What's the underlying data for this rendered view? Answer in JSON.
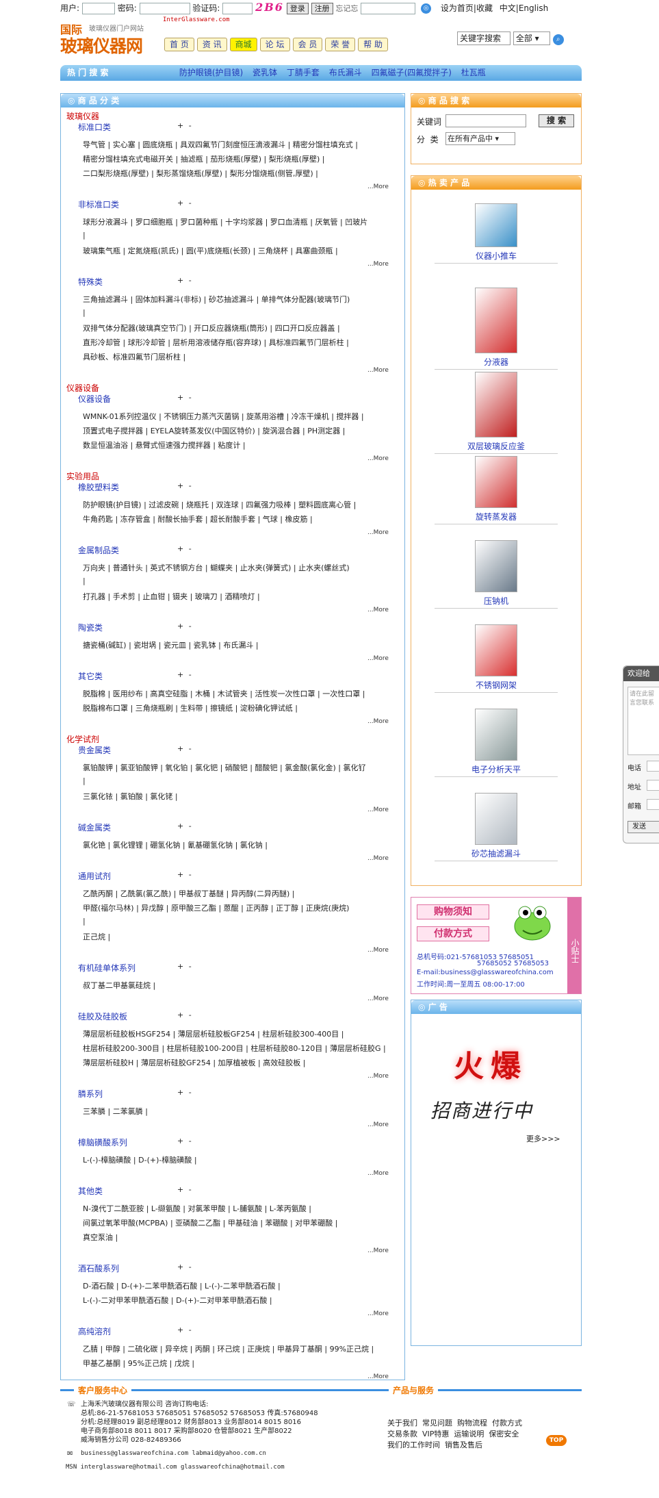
{
  "topbar": {
    "user_label": "用户:",
    "pass_label": "密码:",
    "captcha_label": "验证码:",
    "captcha": "2B6",
    "login": "登录",
    "register": "注册",
    "forgot": "忘记忘",
    "home": "设为首页",
    "fav": "收藏",
    "sep": "|",
    "zh": "中文",
    "en": "English"
  },
  "logo": {
    "prefix": "国际",
    "name": "玻璃仪器网",
    "sub": "玻璃仪器门户网站",
    "site": "InterGlassware.com"
  },
  "nav": [
    "首 页",
    "资 讯",
    "商城",
    "论 坛",
    "会 员",
    "荣 誉",
    "帮 助"
  ],
  "search": {
    "keyword": "关键字搜索",
    "scope": "全部"
  },
  "hot": {
    "label": "热 门 搜 索",
    "links": [
      "防护眼镜(护目镜)",
      "瓷乳钵",
      "丁腈手套",
      "布氏漏斗",
      "四氟磁子(四氟搅拌子)",
      "杜瓦瓶"
    ]
  },
  "category_panel": {
    "title": "商 品 分 类",
    "more": "...More",
    "pm": "+ -"
  },
  "catalog": [
    {
      "group": "玻璃仪器",
      "subs": [
        {
          "name": "标准口类",
          "lines": [
            "导气管 | 实心塞 | 圆底烧瓶 | 具双四氟节门刻度恒压滴液漏斗 | 精密分馏柱填充式 |",
            "精密分馏柱填充式电磁开关 | 抽滤瓶 | 茄形烧瓶(厚壁) | 梨形烧瓶(厚壁) |",
            "二口梨形烧瓶(厚壁) | 梨形蒸馏烧瓶(厚壁) | 梨形分馏烧瓶(侧管,厚壁) |"
          ]
        },
        {
          "name": "非标准口类",
          "lines": [
            "球形分液漏斗 | 罗口细胞瓶 | 罗口菌种瓶 | 十字均浆器 | 罗口血清瓶 | 厌氧管 | 凹玻片",
            "|",
            "玻璃集气瓶 | 定氮烧瓶(凯氏) | 圆(平)底烧瓶(长颈) | 三角烧杯 | 具塞曲颈瓶 |"
          ]
        },
        {
          "name": "特殊类",
          "lines": [
            "三角抽滤漏斗 | 固体加料漏斗(非标) | 砂芯抽滤漏斗 | 单排气体分配器(玻璃节门)",
            "|",
            "双排气体分配器(玻璃真空节门) | 开口反应器烧瓶(筒形) | 四口开口反应器盖 |",
            "直形冷却管 | 球形冷却管 | 层析用溶液储存瓶(容弃球) | 具标准四氟节门层析柱 |",
            "具砂板、标准四氟节门层析柱 |"
          ]
        }
      ]
    },
    {
      "group": "仪器设备",
      "subs": [
        {
          "name": "仪器设备",
          "lines": [
            "WMNK-01系列控温仪 | 不锈钢压力蒸汽灭菌锅 | 旋蒸用浴槽 | 冷冻干燥机 | 搅拌器 |",
            "顶置式电子搅拌器 | EYELA旋转蒸发仪(中国区特价) | 旋涡混合器 | PH测定器 |",
            "数显恒温油浴 | 悬臂式恒速强力搅拌器 | 粘度计 |"
          ]
        }
      ]
    },
    {
      "group": "实验用品",
      "subs": [
        {
          "name": "橡胶塑料类",
          "lines": [
            "防护眼镜(护目镜) | 过滤皮碗 | 烧瓶托 | 双连球 | 四氟强力吸棒 | 塑料圆底离心管 |",
            "牛角药匙 | 冻存管盒 | 耐酸长抽手套 | 超长耐酸手套 | 气球 | 橡皮筋 |"
          ]
        },
        {
          "name": "金属制品类",
          "lines": [
            "万向夹 | 普通针头 | 英式不锈钢方台 | 蝴蝶夹 | 止水夹(弹簧式) | 止水夹(螺丝式)",
            "|",
            "打孔器 | 手术剪 | 止血钳 | 镊夹 | 玻璃刀 | 酒精喷灯 |"
          ]
        },
        {
          "name": "陶瓷类",
          "lines": [
            "搪瓷桶(碱缸) | 瓷坩埚 | 瓷元皿 | 瓷乳钵 | 布氏漏斗 |"
          ]
        },
        {
          "name": "其它类",
          "lines": [
            "脱脂棉 | 医用纱布 | 高真空硅脂 | 木桶 | 木试管夹 | 活性炭一次性口罩 | 一次性口罩 |",
            "脱脂棉布口罩 | 三角烧瓶刷 | 生料带 | 擦镜纸 | 淀粉碘化钾试纸 |"
          ]
        }
      ]
    },
    {
      "group": "化学试剂",
      "subs": [
        {
          "name": "贵金属类",
          "lines": [
            "氯铂酸钾 | 氯亚铂酸钾 | 氧化铂 | 氯化钯 | 硝酸钯 | 醋酸钯 | 氯金酸(氯化金) | 氯化钌",
            "|",
            "三氯化铱 | 氯铂酸 | 氯化铑 |"
          ]
        },
        {
          "name": "碱金属类",
          "lines": [
            "氯化铯 | 氯化锂锂 | 硼氢化钠 | 氰基硼氢化钠 | 氯化钠 |"
          ]
        },
        {
          "name": "通用试剂",
          "lines": [
            "乙酰丙酮 | 乙酰氯(氯乙酰) | 甲基叔丁基醚 | 异丙醇(二异丙醚) |",
            "甲醛(福尔马林) | 异戊醇 | 原甲酸三乙酯 | 蒽醌 | 正丙醇 | 正丁醇 | 正庚烷(庚烷)",
            "|",
            "正己烷 |"
          ]
        },
        {
          "name": "有机硅单体系列",
          "lines": [
            "叔丁基二甲基氯硅烷 |"
          ]
        },
        {
          "name": "硅胶及硅胶板",
          "lines": [
            "薄层层析硅胶板HSGF254 | 薄层层析硅胶板GF254 | 柱层析硅胶300-400目 |",
            "柱层析硅胶200-300目 | 柱层析硅胶100-200目 | 柱层析硅胶80-120目 | 薄层层析硅胶G |",
            "薄层层析硅胶H | 薄层层析硅胶GF254 | 加厚植被板 | 高效硅胶板 |"
          ]
        },
        {
          "name": "膦系列",
          "lines": [
            "三苯膦 | 二苯氯膦 |"
          ]
        },
        {
          "name": "樟脑磺酸系列",
          "lines": [
            "L-(-)-樟脑磺酸 | D-(+)-樟脑磺酸 |"
          ]
        },
        {
          "name": "其他类",
          "lines": [
            "N-溴代丁二酰亚胺 | L-缬氨酸 | 对氯苯甲酸 | L-脯氨酸 | L-苯丙氨酸 |",
            "间氯过氧苯甲酸(MCPBA) | 亚磷酸二乙酯 | 甲基硅油 | 苯硼酸 | 对甲苯硼酸 |",
            "真空泵油 |"
          ]
        },
        {
          "name": "酒石酸系列",
          "lines": [
            "D-酒石酸 | D-(+)-二苯甲酰酒石酸 | L-(-)-二苯甲酰酒石酸 |",
            "L-(-)-二对甲苯甲酰酒石酸 | D-(+)-二对甲苯甲酰酒石酸 |"
          ]
        },
        {
          "name": "高纯溶剂",
          "lines": [
            "乙腈 | 甲醇 | 二硫化碳 | 异辛烷 | 丙酮 | 环己烷 | 正庚烷 | 甲基异丁基酮 | 99%正己烷 |",
            "甲基乙基酮 | 95%正己烷 | 戊烷 |"
          ]
        }
      ]
    }
  ],
  "product_search": {
    "title": "商 品 搜 索",
    "keyword_label": "关键词",
    "button": "搜 索",
    "category_label": "分  类",
    "category_value": "在所有产品中"
  },
  "hot_products": {
    "title": "热 卖 产 品",
    "items": [
      {
        "name": "仪器小推车",
        "color": "#3a90c8"
      },
      {
        "name": "分液器",
        "color": "#d33030"
      },
      {
        "name": "双层玻璃反应釜",
        "color": "#c02020"
      },
      {
        "name": "旋转蒸发器",
        "color": "#d03030"
      },
      {
        "name": "压钠机",
        "color": "#6a7a8a"
      },
      {
        "name": "不锈钢网架",
        "color": "#d83030"
      },
      {
        "name": "电子分析天平",
        "color": "#8a9a9a"
      },
      {
        "name": "砂芯抽滤漏斗",
        "color": "#b0b8c0"
      }
    ]
  },
  "tips": {
    "buy": "购物须知",
    "pay": "付款方式",
    "side": "小贴士",
    "line1": "总机号码:021-57681053  57685051",
    "line2": "57685052  57685053",
    "line3": "E-mail:business@glasswareofchina.com",
    "line4": "工作时间:周一至周五  08:00-17:00"
  },
  "ad": {
    "title": "广 告",
    "hot": "火爆",
    "recruit": "招商进行中",
    "more": "更多>>>"
  },
  "footer": {
    "service_title": "客户服务中心",
    "service_lines": [
      "上海禾汽玻璃仪器有限公司 咨询订购电话:",
      "总机:86-21-57681053 57685051 57685052 57685053 传真:57680948",
      "分机:总经理8019 副总经理8012 财务部8013 业务部8014 8015 8016",
      "电子商务部8018 8011 8017 采购部8020 仓管部8021 生产部8022",
      "威海销售分公司 028-82489366",
      "business@glasswareofchina.com labmaid@yahoo.com.cn",
      "MSN interglassware@hotmail.com glasswareofchina@hotmail.com"
    ],
    "products_title": "产品与服务",
    "links1": "关于我们  常见问题  购物流程  付款方式",
    "links2": "交易条款  VIP特惠  运输说明  保密安全",
    "links3": "我们的工作时间  销售及售后",
    "top": "TOP"
  },
  "sidebar": {
    "title": "欢迎给",
    "placeholder": "请在此留言您联系",
    "phone": "电话",
    "addr": "地址",
    "mail": "邮箱",
    "send": "发送"
  }
}
